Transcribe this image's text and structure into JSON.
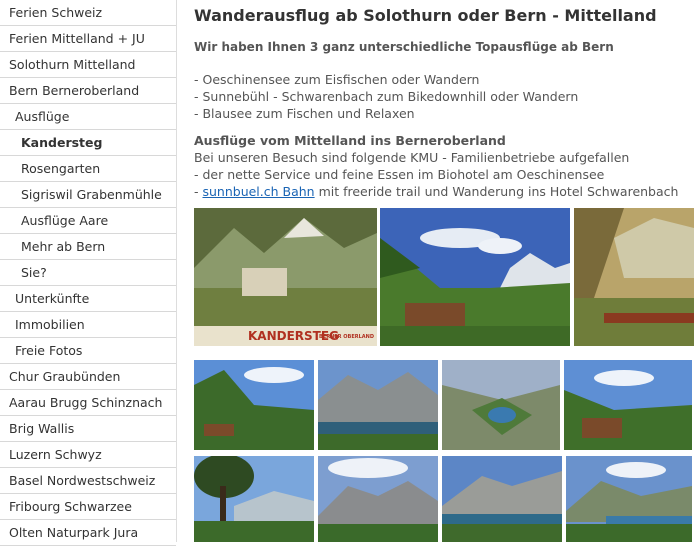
{
  "sidebar": {
    "items": [
      {
        "label": "Ferien Schweiz"
      },
      {
        "label": "Ferien Mittelland + JU"
      },
      {
        "label": "Solothurn Mittelland"
      },
      {
        "label": "Bern Berneroberland"
      },
      {
        "label": "Ausflüge"
      },
      {
        "label": "Kandersteg"
      },
      {
        "label": "Rosengarten"
      },
      {
        "label": "Sigriswil Grabenmühle"
      },
      {
        "label": "Ausflüge Aare"
      },
      {
        "label": "Mehr ab Bern"
      },
      {
        "label": "Sie?"
      },
      {
        "label": "Unterkünfte"
      },
      {
        "label": "Immobilien"
      },
      {
        "label": "Freie Fotos"
      },
      {
        "label": "Chur Graubünden"
      },
      {
        "label": "Aarau Brugg Schinznach"
      },
      {
        "label": "Brig Wallis"
      },
      {
        "label": "Luzern Schwyz"
      },
      {
        "label": "Basel Nordwestschweiz"
      },
      {
        "label": "Fribourg Schwarzee"
      },
      {
        "label": "Olten Naturpark Jura"
      }
    ]
  },
  "main": {
    "title": "Wanderausflug ab Solothurn oder Bern - Mittelland",
    "intro": "Wir haben Ihnen 3 ganz unterschiedliche Topausflüge ab Bern",
    "list": [
      "- Oeschinensee zum Eisfischen oder Wandern",
      "- Sunnebühl - Schwarenbach zum Bikedownhill oder Wandern",
      "- Blausee zum Fischen und Relaxen"
    ],
    "section_heading": "Ausflüge vom Mittelland ins Berneroberland",
    "section_line1": "Bei unseren Besuch sind folgende KMU - Familienbetriebe  aufgefallen",
    "section_line2": "- der nette Service und feine Essen im Biohotel am Oeschinensee",
    "section_link": "sunnbuel.ch Bahn",
    "section_line3_rest": " mit freeride trail und Wanderung ins Hotel Schwarenbach",
    "poster_caption": "KANDERSTEG",
    "poster_caption2": "BERNER OBERLAND"
  }
}
